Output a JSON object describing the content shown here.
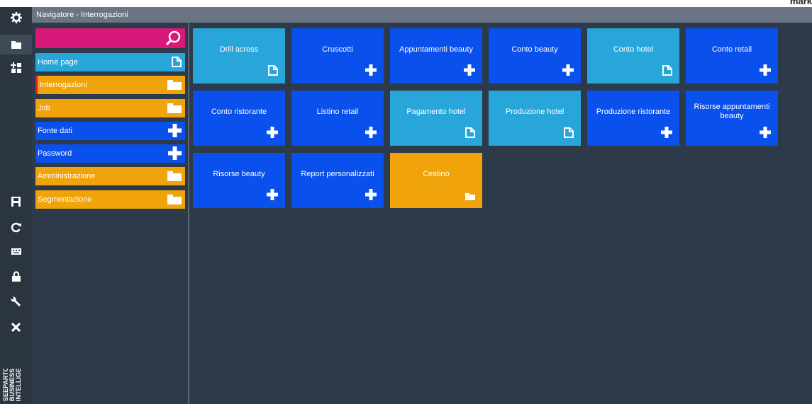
{
  "corner_text": "mark",
  "window": {
    "title": "Navigatore - Interrogazioni"
  },
  "rail": {
    "brand_text": "SEEPARTOUT BUSINESS INTELLIGENCE",
    "icons": [
      "gear-icon",
      "folder-open-icon",
      "add-tiles-icon",
      "save-icon",
      "refresh-icon",
      "keyboard-icon",
      "lock-icon",
      "wrench-icon",
      "close-icon"
    ]
  },
  "search": {
    "icon": "search-icon"
  },
  "nav": {
    "items": [
      {
        "label": "Home page",
        "icon": "document-icon",
        "color": "#29a6d9"
      },
      {
        "label": "Interrogazioni",
        "icon": "folder-icon",
        "color": "#f0a30a",
        "marked": true
      },
      {
        "label": "Job",
        "icon": "folder-icon",
        "color": "#f0a30a"
      },
      {
        "label": "Fonte dati",
        "icon": "plus-icon",
        "color": "#0a50ec"
      },
      {
        "label": "Password",
        "icon": "plus-icon",
        "color": "#0a50ec"
      },
      {
        "label": "Amministrazione",
        "icon": "folder-icon",
        "color": "#f0a30a"
      },
      {
        "label": "Segmentazione",
        "icon": "folder-icon",
        "color": "#f0a30a"
      }
    ]
  },
  "tiles": [
    {
      "label": "Drill across",
      "icon": "document-icon",
      "color": "#29a6d9"
    },
    {
      "label": "Cruscotti",
      "icon": "plus-icon",
      "color": "#0a50ec"
    },
    {
      "label": "Appuntamenti beauty",
      "icon": "plus-icon",
      "color": "#0a50ec"
    },
    {
      "label": "Conto beauty",
      "icon": "plus-icon",
      "color": "#0a50ec"
    },
    {
      "label": "Conto hotel",
      "icon": "document-icon",
      "color": "#29a6d9"
    },
    {
      "label": "Conto retail",
      "icon": "plus-icon",
      "color": "#0a50ec"
    },
    {
      "label": "Conto ristorante",
      "icon": "plus-icon",
      "color": "#0a50ec"
    },
    {
      "label": "Listino retail",
      "icon": "plus-icon",
      "color": "#0a50ec"
    },
    {
      "label": "Pagamento hotel",
      "icon": "document-icon",
      "color": "#29a6d9"
    },
    {
      "label": "Produzione hotel",
      "icon": "document-icon",
      "color": "#29a6d9"
    },
    {
      "label": "Produzione ristorante",
      "icon": "plus-icon",
      "color": "#0a50ec"
    },
    {
      "label": "Risorse appuntamenti beauty",
      "icon": "plus-icon",
      "color": "#0a50ec"
    },
    {
      "label": "Risorse beauty",
      "icon": "plus-icon",
      "color": "#0a50ec"
    },
    {
      "label": "Report personalizzati",
      "icon": "plus-icon",
      "color": "#0a50ec"
    },
    {
      "label": "Cestino",
      "icon": "folder-icon",
      "color": "#f0a30a"
    }
  ]
}
